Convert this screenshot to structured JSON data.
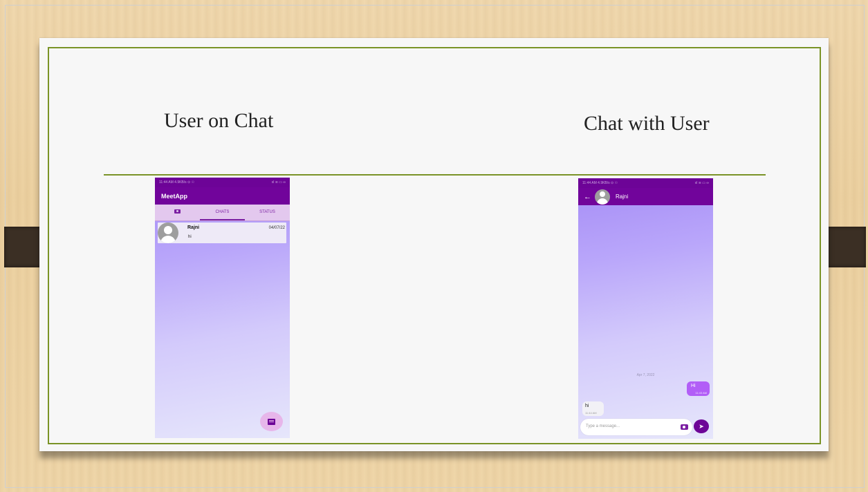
{
  "slide": {
    "title_left": "User on Chat",
    "title_right": "Chat with User"
  },
  "left_phone": {
    "status_left": "11:44 AM 4.9KB/s ⊙ ☉",
    "status_right": "ııl ≋ ▭ ∞",
    "app_title": "MeetApp",
    "tabs": [
      {
        "icon": "camera-icon",
        "label": ""
      },
      {
        "label": "CHATS",
        "active": true
      },
      {
        "label": "STATUS"
      }
    ],
    "chats": [
      {
        "name": "Rajni",
        "date": "04/07/22",
        "preview": "hi"
      }
    ],
    "fab_icon": "new-message-icon"
  },
  "right_phone": {
    "status_left": "11:44 AM 4.9KB/s ⊙ ☉",
    "status_right": "ııl ≋ ▭ ∞",
    "contact_name": "Rajni",
    "date_separator": "Apr 7, 2022",
    "messages": [
      {
        "direction": "out",
        "text": "Hi",
        "time": "11:43 AM"
      },
      {
        "direction": "in",
        "text": "hi",
        "time": "11:44 AM"
      }
    ],
    "input_placeholder": "Type a message...",
    "colors": {
      "primary": "#71049b",
      "outgoing_bubble": "#b25ef7"
    }
  }
}
